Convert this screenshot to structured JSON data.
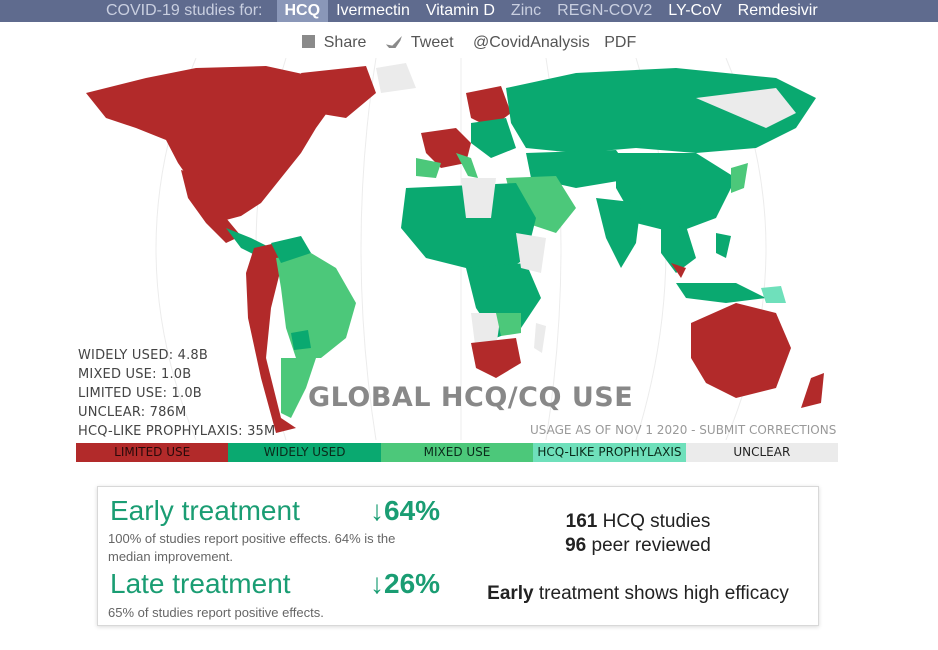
{
  "nav": {
    "lead": "COVID-19 studies for:",
    "items": [
      {
        "label": "HCQ",
        "active": true
      },
      {
        "label": "Ivermectin"
      },
      {
        "label": "Vitamin D"
      },
      {
        "label": "Zinc"
      },
      {
        "label": "REGN-COV2"
      },
      {
        "label": "LY-CoV"
      },
      {
        "label": "Remdesivir"
      }
    ]
  },
  "share": {
    "share": "Share",
    "tweet": "Tweet",
    "handle": "@CovidAnalysis",
    "pdf": "PDF"
  },
  "map": {
    "title": "GLOBAL HCQ/CQ USE",
    "usage_note": "USAGE AS OF NOV 1 2020 - SUBMIT CORRECTIONS",
    "stats": [
      "WIDELY USED: 4.8B",
      "MIXED USE: 1.0B",
      "LIMITED USE: 1.0B",
      "UNCLEAR: 786M",
      "HCQ-LIKE PROPHYLAXIS: 35M"
    ],
    "colors": {
      "limited": "#b22a2a",
      "widely": "#0aa970",
      "mixed": "#4cc87a",
      "prophylaxis": "#6fe0bb",
      "unclear": "#ebebeb"
    },
    "legend": [
      {
        "label": "LIMITED USE",
        "color": "#b22a2a",
        "text": "#2a0a0a"
      },
      {
        "label": "WIDELY USED",
        "color": "#0aa970",
        "text": "#0a2a1a"
      },
      {
        "label": "MIXED USE",
        "color": "#4cc87a",
        "text": "#0a2a1a"
      },
      {
        "label": "HCQ-LIKE PROPHYLAXIS",
        "color": "#6fe0bb",
        "text": "#0a2a1a"
      },
      {
        "label": "UNCLEAR",
        "color": "#ebebeb",
        "text": "#222222"
      }
    ]
  },
  "summary": {
    "early": {
      "title": "Early treatment",
      "pct": "↓64%",
      "desc": "100% of studies report positive effects. 64% is the median improvement."
    },
    "late": {
      "title": "Late treatment",
      "pct": "↓26%",
      "desc": "65% of studies report positive effects."
    },
    "studies_count": "161",
    "studies_label": "HCQ studies",
    "peer_count": "96",
    "peer_label": "peer reviewed",
    "efficacy_bold": "Early",
    "efficacy_rest": "treatment shows high efficacy"
  }
}
